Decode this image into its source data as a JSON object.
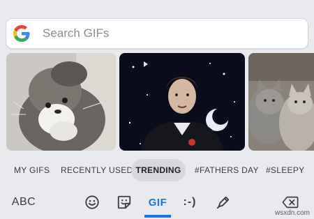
{
  "search": {
    "placeholder": "Search GIFs",
    "icon": "google-g-icon"
  },
  "gifs": [
    {
      "subject": "cat",
      "icon": "gif-thumbnail"
    },
    {
      "subject": "man-on-stage",
      "icon": "gif-thumbnail"
    },
    {
      "subject": "cats",
      "icon": "gif-thumbnail"
    }
  ],
  "tabs": {
    "my_gifs": "MY GIFS",
    "recently_used": "RECENTLY USED",
    "trending": "TRENDING",
    "fathers_day": "#FATHERS DAY",
    "sleepy": "#SLEEPY",
    "active": "trending"
  },
  "toolbar": {
    "abc": "ABC",
    "gif": "GIF",
    "emoticon": ":-)",
    "icons": [
      "emoji-icon",
      "sticker-icon",
      "gif-tab",
      "emoticon-tab",
      "pen-icon",
      "backspace-icon"
    ]
  },
  "colors": {
    "accent": "#1a73e8",
    "background": "#e9eaee",
    "active_tab": "#d7d8dc"
  },
  "watermark": "wsxdn.com"
}
